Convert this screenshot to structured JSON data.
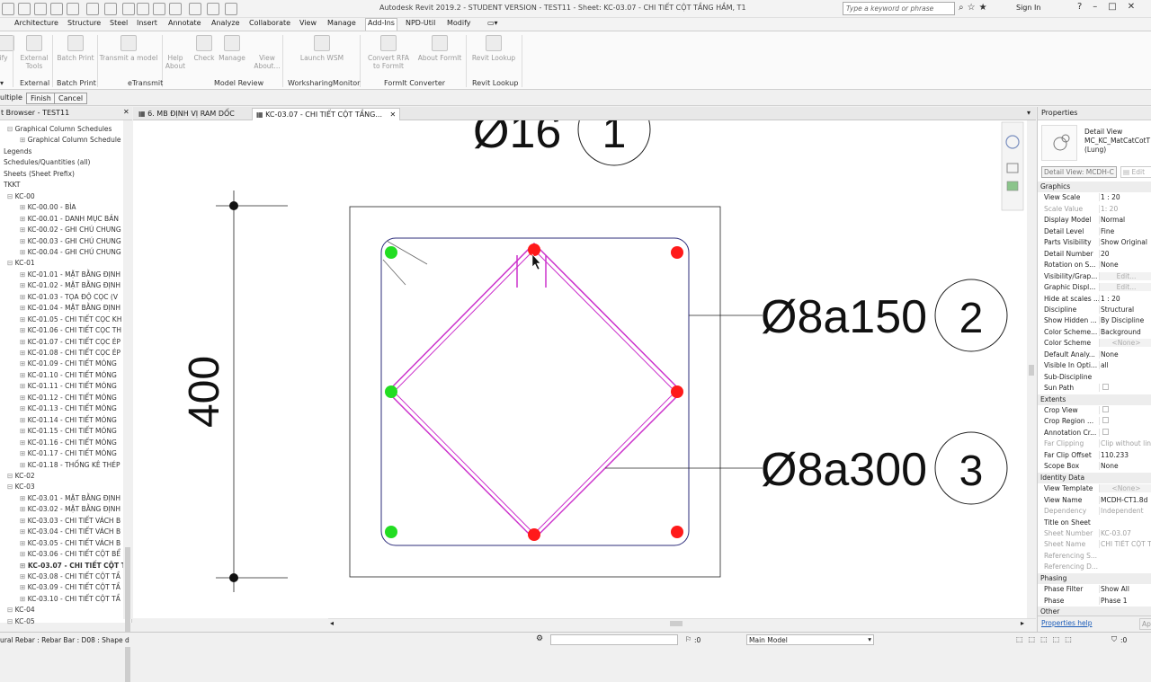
{
  "title_bar": {
    "title": "Autodesk Revit 2019.2 - STUDENT VERSION - TEST11 - Sheet: KC-03.07 - CHI TIẾT CỘT TẦNG HẦM, T1",
    "search_placeholder": "Type a keyword or phrase",
    "sign_in": "Sign In"
  },
  "menu_tabs": [
    "Architecture",
    "Structure",
    "Steel",
    "Insert",
    "Annotate",
    "Analyze",
    "Collaborate",
    "View",
    "Manage",
    "Add-Ins",
    "NPD-Util",
    "Modify"
  ],
  "active_tab": "Add-Ins",
  "ribbon": {
    "buttons": {
      "modify": "ify",
      "external_tools": "External Tools",
      "batch_print": "Batch Print",
      "transmit": "Transmit a model",
      "help": "Help",
      "about": "About",
      "check": "Check",
      "manage": "Manage",
      "view_about": "View About...",
      "launch_wsm": "Launch WSM",
      "convert_rfa": "Convert RFA to FormIt",
      "about_formit": "About FormIt",
      "revit_lookup": "Revit Lookup"
    },
    "panels": {
      "external": "External",
      "batch_print": "Batch Print",
      "etransmit": "eTransmit",
      "model_review": "Model Review",
      "worksharing": "WorksharingMonitor",
      "formit": "FormIt Converter",
      "revit_lookup": "Revit Lookup"
    }
  },
  "options_bar": {
    "multiple": "ultiple",
    "finish": "Finish",
    "cancel": "Cancel"
  },
  "project_browser": {
    "header": "t Browser - TEST11",
    "items": [
      {
        "label": "Graphical Column Schedules",
        "indent": 1
      },
      {
        "label": "Graphical Column Schedule",
        "indent": 2
      },
      {
        "label": "Legends",
        "indent": 0
      },
      {
        "label": "Schedules/Quantities (all)",
        "indent": 0
      },
      {
        "label": "Sheets (Sheet Prefix)",
        "indent": 0
      },
      {
        "label": "TKKT",
        "indent": 0
      },
      {
        "label": "KC-00",
        "indent": 1
      },
      {
        "label": "KC-00.00 - BÌA",
        "indent": 2
      },
      {
        "label": "KC-00.01 - DANH MỤC BẢN",
        "indent": 2
      },
      {
        "label": "KC-00.02 - GHI CHÚ CHUNG",
        "indent": 2
      },
      {
        "label": "KC-00.03 - GHI CHÚ CHUNG",
        "indent": 2
      },
      {
        "label": "KC-00.04 - GHI CHÚ CHUNG",
        "indent": 2
      },
      {
        "label": "KC-01",
        "indent": 1
      },
      {
        "label": "KC-01.01 - MẶT BẰNG ĐỊNH",
        "indent": 2
      },
      {
        "label": "KC-01.02 - MẶT BẰNG ĐỊNH",
        "indent": 2
      },
      {
        "label": "KC-01.03 - TỌA ĐỘ CỌC (V",
        "indent": 2
      },
      {
        "label": "KC-01.04 - MẶT BẰNG ĐỊNH",
        "indent": 2
      },
      {
        "label": "KC-01.05 - CHI TIẾT CỌC KH",
        "indent": 2
      },
      {
        "label": "KC-01.06 - CHI TIẾT CỌC TH",
        "indent": 2
      },
      {
        "label": "KC-01.07 - CHI TIẾT CỌC ÉP",
        "indent": 2
      },
      {
        "label": "KC-01.08 - CHI TIẾT CỌC ÉP",
        "indent": 2
      },
      {
        "label": "KC-01.09 - CHI TIẾT MÓNG",
        "indent": 2
      },
      {
        "label": "KC-01.10 - CHI TIẾT MÓNG",
        "indent": 2
      },
      {
        "label": "KC-01.11 - CHI TIẾT MÓNG",
        "indent": 2
      },
      {
        "label": "KC-01.12 - CHI TIẾT MÓNG",
        "indent": 2
      },
      {
        "label": "KC-01.13 - CHI TIẾT MÓNG",
        "indent": 2
      },
      {
        "label": "KC-01.14 - CHI TIẾT MÓNG",
        "indent": 2
      },
      {
        "label": "KC-01.15 - CHI TIẾT MÓNG",
        "indent": 2
      },
      {
        "label": "KC-01.16 - CHI TIẾT MÓNG",
        "indent": 2
      },
      {
        "label": "KC-01.17 - CHI TIẾT MÓNG",
        "indent": 2
      },
      {
        "label": "KC-01.18 - THỐNG KÊ THÉP",
        "indent": 2
      },
      {
        "label": "KC-02",
        "indent": 1
      },
      {
        "label": "KC-03",
        "indent": 1
      },
      {
        "label": "KC-03.01 - MẶT BẰNG ĐỊNH",
        "indent": 2
      },
      {
        "label": "KC-03.02 - MẶT BẰNG ĐỊNH",
        "indent": 2
      },
      {
        "label": "KC-03.03 - CHI TIẾT VÁCH B",
        "indent": 2
      },
      {
        "label": "KC-03.04 - CHI TIẾT VÁCH B",
        "indent": 2
      },
      {
        "label": "KC-03.05 - CHI TIẾT VÁCH B",
        "indent": 2
      },
      {
        "label": "KC-03.06 - CHI TIẾT CỘT BỂ",
        "indent": 2
      },
      {
        "label": "KC-03.07 - CHI TIẾT CỘT T",
        "indent": 2,
        "bold": true
      },
      {
        "label": "KC-03.08 - CHI TIẾT CỘT TẦ",
        "indent": 2
      },
      {
        "label": "KC-03.09 - CHI TIẾT CỘT TẦ",
        "indent": 2
      },
      {
        "label": "KC-03.10 - CHI TIẾT CỘT TẦ",
        "indent": 2
      },
      {
        "label": "KC-04",
        "indent": 1
      },
      {
        "label": "KC-05",
        "indent": 1
      }
    ]
  },
  "view_tabs": [
    {
      "label": "6. MB ĐỊNH VỊ RAM DỐC",
      "active": false
    },
    {
      "label": "KC-03.07 - CHI TIẾT CỘT TẦNG...",
      "active": true
    }
  ],
  "drawing": {
    "top_tag_text": "Ø16",
    "top_tag_number": "1",
    "dimension": "400",
    "tag2_text": "Ø8a150",
    "tag2_number": "2",
    "tag3_text": "Ø8a300",
    "tag3_number": "3",
    "colors": {
      "rebar_red": "#ff1a1a",
      "rebar_green": "#22dd22",
      "stirrup": "#cc33cc",
      "line": "#2b2b7a"
    }
  },
  "properties": {
    "header": "Properties",
    "type_lines": [
      "Detail View",
      "MC_KC_MatCatCotT",
      "(Lung)"
    ],
    "selector": "Detail View: MCDH-C",
    "edit_type": "Edit",
    "help_link": "Properties help",
    "apply": "App",
    "rows": [
      {
        "group": "Graphics"
      },
      {
        "label": "View Scale",
        "value": "1 : 20"
      },
      {
        "label": "Scale Value",
        "value": "1:  20",
        "grey": true
      },
      {
        "label": "Display Model",
        "value": "Normal"
      },
      {
        "label": "Detail Level",
        "value": "Fine"
      },
      {
        "label": "Parts Visibility",
        "value": "Show Original"
      },
      {
        "label": "Detail Number",
        "value": "20"
      },
      {
        "label": "Rotation on S...",
        "value": "None"
      },
      {
        "label": "Visibility/Grap...",
        "value": "Edit...",
        "btn": true
      },
      {
        "label": "Graphic Displ...",
        "value": "Edit...",
        "btn": true
      },
      {
        "label": "Hide at scales ...",
        "value": "1 : 20"
      },
      {
        "label": "Discipline",
        "value": "Structural"
      },
      {
        "label": "Show Hidden ...",
        "value": "By Discipline"
      },
      {
        "label": "Color Scheme...",
        "value": "Background"
      },
      {
        "label": "Color Scheme",
        "value": "<None>",
        "btn": true
      },
      {
        "label": "Default Analy...",
        "value": "None"
      },
      {
        "label": "Visible In Opti...",
        "value": "all"
      },
      {
        "label": "Sub-Discipline",
        "value": ""
      },
      {
        "label": "Sun Path",
        "value": "",
        "check": true
      },
      {
        "group": "Extents"
      },
      {
        "label": "Crop View",
        "value": "",
        "check": true
      },
      {
        "label": "Crop Region ...",
        "value": "",
        "check": true
      },
      {
        "label": "Annotation Cr...",
        "value": "",
        "check": true
      },
      {
        "label": "Far Clipping",
        "value": "Clip without line",
        "grey": true
      },
      {
        "label": "Far Clip Offset",
        "value": "110.233"
      },
      {
        "label": "Scope Box",
        "value": "None"
      },
      {
        "group": "Identity Data"
      },
      {
        "label": "View Template",
        "value": "<None>",
        "btn": true
      },
      {
        "label": "View Name",
        "value": "MCDH-CT1.8d"
      },
      {
        "label": "Dependency",
        "value": "Independent",
        "grey": true
      },
      {
        "label": "Title on Sheet",
        "value": ""
      },
      {
        "label": "Sheet Number",
        "value": "KC-03.07",
        "grey": true
      },
      {
        "label": "Sheet Name",
        "value": "CHI TIẾT CỘT T",
        "grey": true
      },
      {
        "label": "Referencing S...",
        "value": "",
        "grey": true
      },
      {
        "label": "Referencing D...",
        "value": "",
        "grey": true
      },
      {
        "group": "Phasing"
      },
      {
        "label": "Phase Filter",
        "value": "Show All"
      },
      {
        "label": "Phase",
        "value": "Phase 1"
      },
      {
        "group": "Other"
      }
    ]
  },
  "status_bar": {
    "message": "ural Rebar : Rebar Bar : D08 : Shape d",
    "coord": ":0",
    "model": "Main Model",
    "filter_count": ":0"
  }
}
